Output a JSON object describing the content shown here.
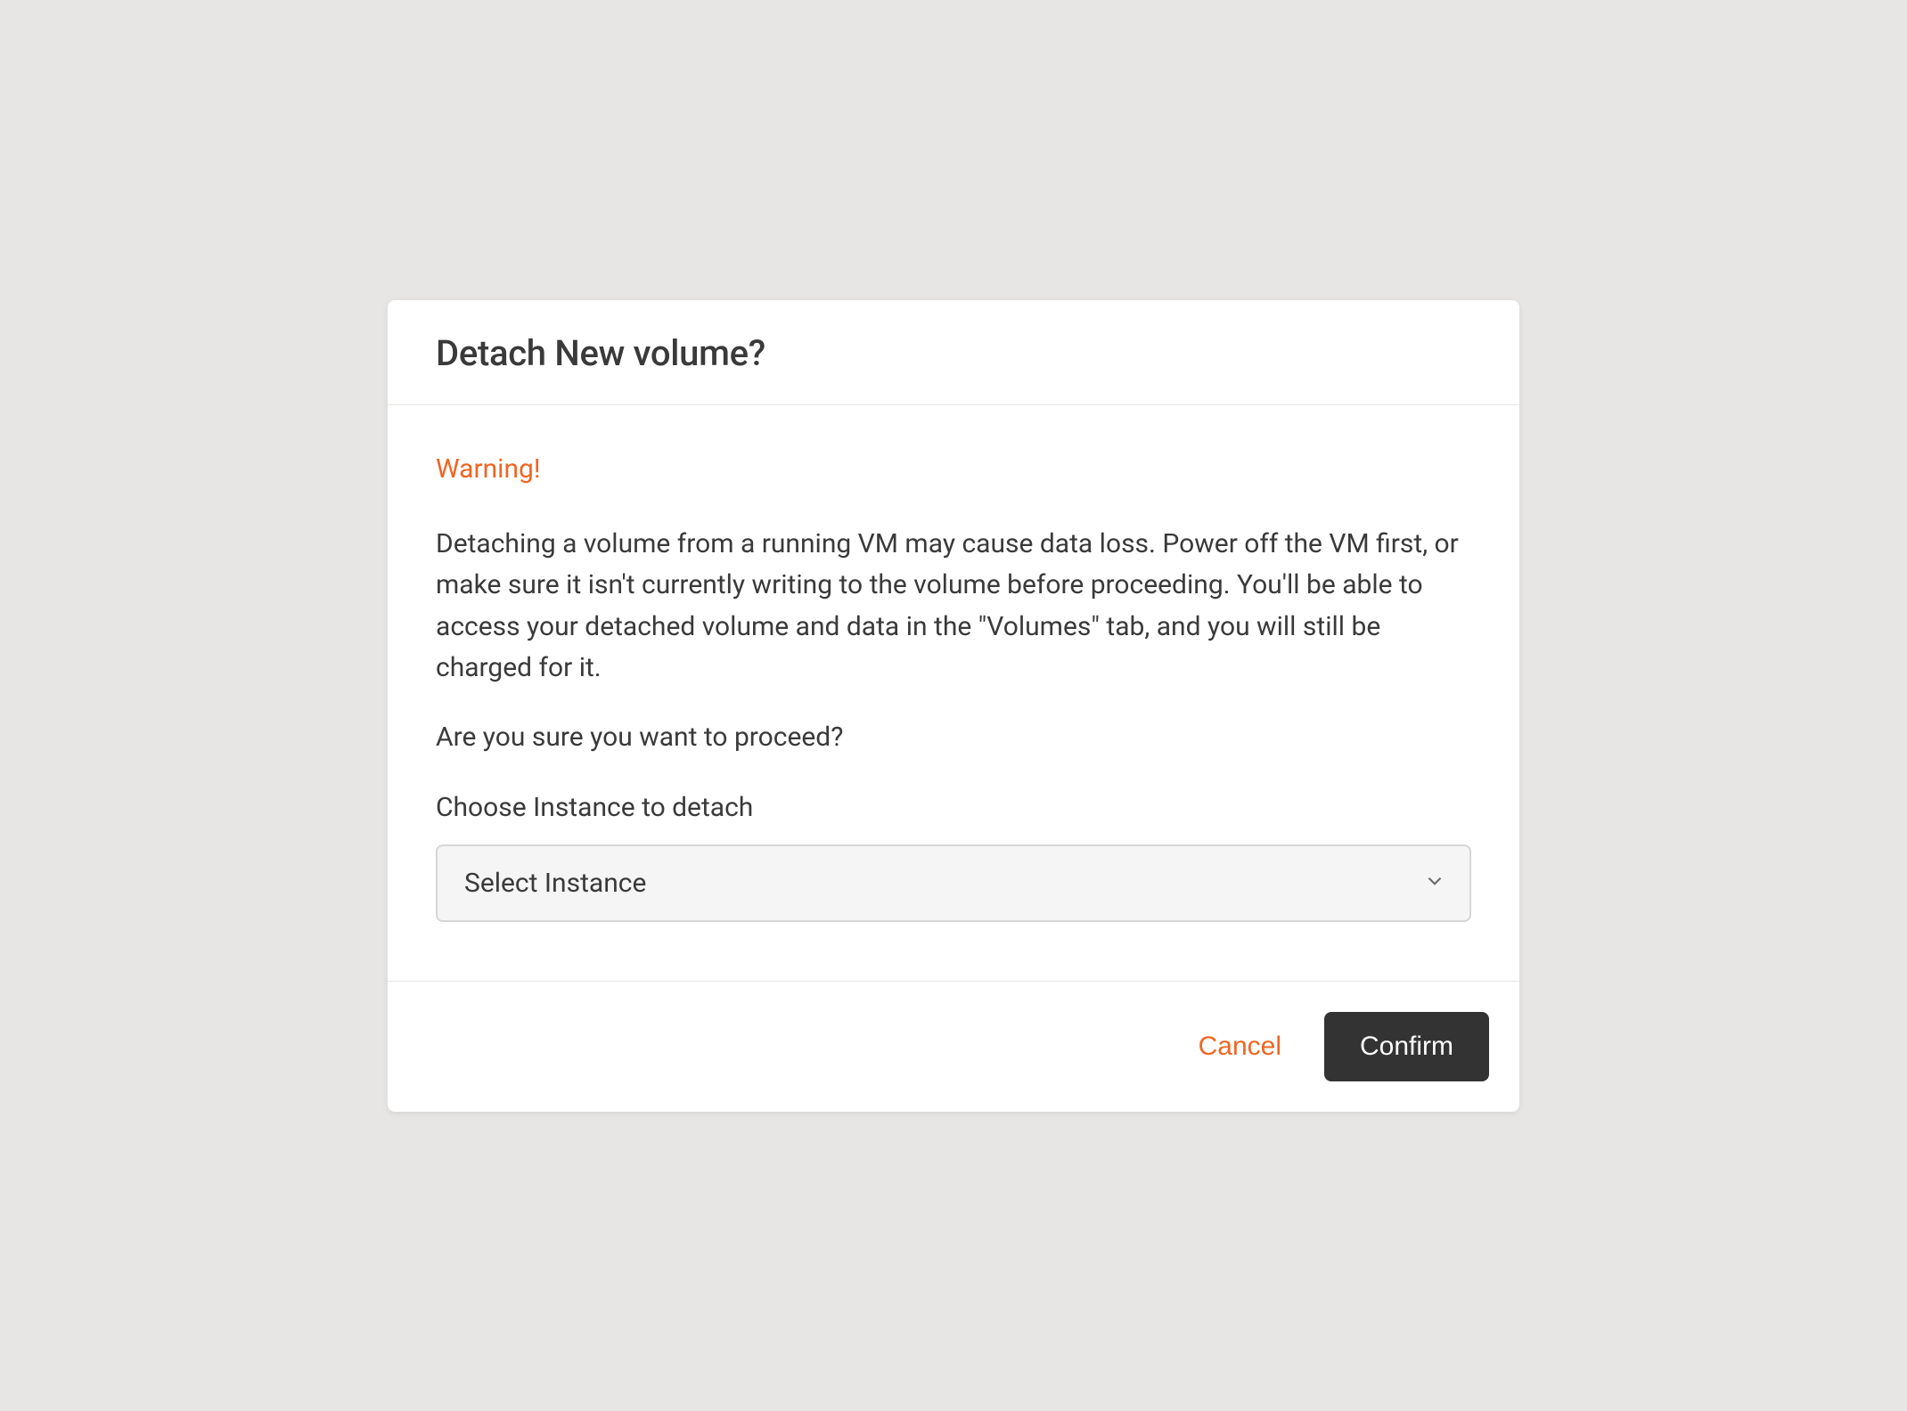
{
  "modal": {
    "title": "Detach New volume?",
    "warning_heading": "Warning!",
    "body_text": "Detaching a volume from a running VM may cause data loss. Power off the VM first, or make sure it isn't currently writing to the volume before proceeding. You'll be able to access your detached volume and data in the \"Volumes\" tab, and you will still be charged for it.",
    "confirm_text": "Are you sure you want to proceed?",
    "field_label": "Choose Instance to detach",
    "select": {
      "placeholder": "Select Instance"
    },
    "buttons": {
      "cancel": "Cancel",
      "confirm": "Confirm"
    }
  },
  "colors": {
    "accent": "#f26522",
    "dark": "#333333"
  }
}
